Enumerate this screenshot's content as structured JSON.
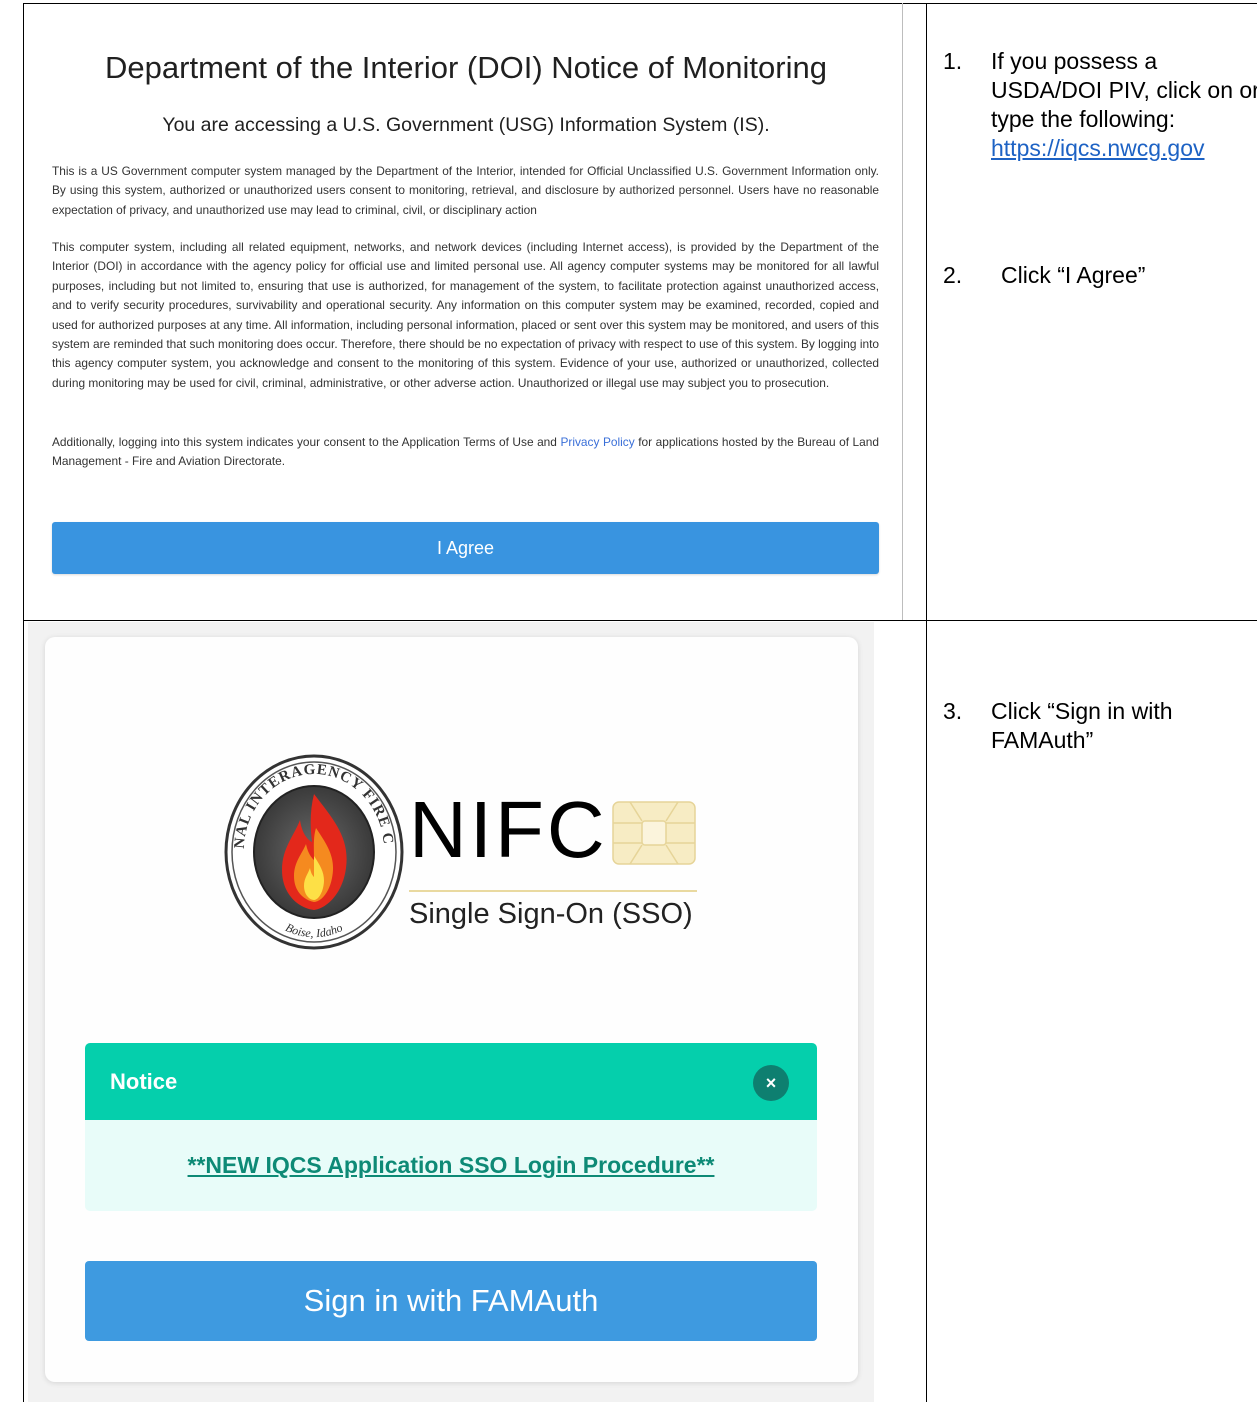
{
  "doi_notice": {
    "title": "Department of the Interior (DOI) Notice of Monitoring",
    "subtitle": "You are accessing a U.S. Government (USG) Information System (IS).",
    "paragraph1": "This is a US Government computer system managed by the Department of the Interior, intended for Official Unclassified U.S. Government Information only. By using this system, authorized or unauthorized users consent to monitoring, retrieval, and disclosure by authorized personnel. Users have no reasonable expectation of privacy, and unauthorized use may lead to criminal, civil, or disciplinary action",
    "paragraph2": "This computer system, including all related equipment, networks, and network devices (including Internet access), is provided by the Department of the Interior (DOI) in accordance with the agency policy for official use and limited personal use. All agency computer systems may be monitored for all lawful purposes, including but not limited to, ensuring that use is authorized, for management of the system, to facilitate protection against unauthorized access, and to verify security procedures, survivability and operational security. Any information on this computer system may be examined, recorded, copied and used for authorized purposes at any time. All information, including personal information, placed or sent over this system may be monitored, and users of this system are reminded that such monitoring does occur. Therefore, there should be no expectation of privacy with respect to use of this system. By logging into this agency computer system, you acknowledge and consent to the monitoring of this system. Evidence of your use, authorized or unauthorized, collected during monitoring may be used for civil, criminal, administrative, or other adverse action. Unauthorized or illegal use may subject you to prosecution.",
    "paragraph3_before": "Additionally, logging into this system indicates your consent to the Application Terms of Use and ",
    "paragraph3_link": "Privacy Policy",
    "paragraph3_after": " for applications hosted by the Bureau of Land Management - Fire and Aviation Directorate.",
    "agree_label": "I Agree"
  },
  "instructions": {
    "step1_num": "1.",
    "step1_text": "If you possess a USDA/DOI PIV, click on or type the following:",
    "step1_link": "https://iqcs.nwcg.gov",
    "step2_num": "2.",
    "step2_text": "Click “I Agree”",
    "step3_num": "3.",
    "step3_text": "Click “Sign in with FAMAuth”"
  },
  "sso": {
    "seal_top_text": "NATIONAL INTERAGENCY FIRE CENTER",
    "seal_bottom_text": "Boise, Idaho",
    "brand": "NIFC",
    "subtitle": "Single Sign-On (SSO)",
    "notice_heading": "Notice",
    "notice_close": "×",
    "notice_link": "**NEW IQCS Application SSO Login Procedure**",
    "signin_label": "Sign in with FAMAuth"
  },
  "colors": {
    "agree_button": "#3994e0",
    "notice_header": "#05cfac",
    "notice_body": "#e8fcf9",
    "signin_button": "#3e9ae0",
    "link": "#1d62c4"
  }
}
